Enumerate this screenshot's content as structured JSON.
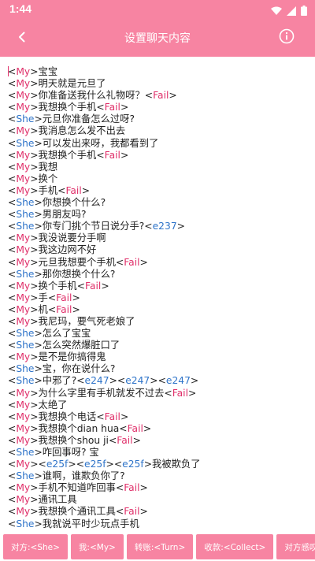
{
  "status_bar": {
    "time": "1:44",
    "colors": {
      "background": "#f784a2",
      "text": "#ffffff"
    }
  },
  "app_bar": {
    "title": "设置聊天内容",
    "back_icon": "arrow-back-icon",
    "info_icon": "info-icon"
  },
  "theme": {
    "accent": "#f784a2",
    "my_tag_color": "#e0306a",
    "she_tag_color": "#2f74c9"
  },
  "editor": {
    "lines": [
      {
        "speaker": "My",
        "parts": [
          {
            "text": "宝宝"
          }
        ]
      },
      {
        "speaker": "My",
        "parts": [
          {
            "text": "明天就是元旦了"
          }
        ]
      },
      {
        "speaker": "My",
        "parts": [
          {
            "text": "你准备送我什么礼物呀？"
          },
          {
            "token": "Fail"
          }
        ]
      },
      {
        "speaker": "My",
        "parts": [
          {
            "text": "我想换个手机"
          },
          {
            "token": "Fail"
          }
        ]
      },
      {
        "speaker": "She",
        "parts": [
          {
            "text": "元旦你准备怎么过呀?"
          }
        ]
      },
      {
        "speaker": "My",
        "parts": [
          {
            "text": "我消息怎么发不出去"
          }
        ]
      },
      {
        "speaker": "She",
        "parts": [
          {
            "text": "可以发出来呀，我都看到了"
          }
        ]
      },
      {
        "speaker": "My",
        "parts": [
          {
            "text": "我想换个手机"
          },
          {
            "token": "Fail"
          }
        ]
      },
      {
        "speaker": "My",
        "parts": [
          {
            "text": "我想"
          }
        ]
      },
      {
        "speaker": "My",
        "parts": [
          {
            "text": "换个"
          }
        ]
      },
      {
        "speaker": "My",
        "parts": [
          {
            "text": "手机"
          },
          {
            "token": "Fail"
          }
        ]
      },
      {
        "speaker": "She",
        "parts": [
          {
            "text": "你想换个什么?"
          }
        ]
      },
      {
        "speaker": "She",
        "parts": [
          {
            "text": "男朋友吗?"
          }
        ]
      },
      {
        "speaker": "She",
        "parts": [
          {
            "text": "你专门挑个节日说分手?"
          },
          {
            "code": "e237"
          }
        ]
      },
      {
        "speaker": "My",
        "parts": [
          {
            "text": "我没说要分手啊"
          }
        ]
      },
      {
        "speaker": "My",
        "parts": [
          {
            "text": "我这边网不好"
          }
        ]
      },
      {
        "speaker": "My",
        "parts": [
          {
            "text": "元旦我想要个手机"
          },
          {
            "token": "Fail"
          }
        ]
      },
      {
        "speaker": "She",
        "parts": [
          {
            "text": "那你想换个什么?"
          }
        ]
      },
      {
        "speaker": "My",
        "parts": [
          {
            "text": "换个手机"
          },
          {
            "token": "Fail"
          }
        ]
      },
      {
        "speaker": "My",
        "parts": [
          {
            "text": "手"
          },
          {
            "token": "Fail"
          }
        ]
      },
      {
        "speaker": "My",
        "parts": [
          {
            "text": "机"
          },
          {
            "token": "Fail"
          }
        ]
      },
      {
        "speaker": "My",
        "parts": [
          {
            "text": "我尼玛，要气死老娘了"
          }
        ]
      },
      {
        "speaker": "She",
        "parts": [
          {
            "text": "怎么了宝宝"
          }
        ]
      },
      {
        "speaker": "She",
        "parts": [
          {
            "text": "怎么突然爆脏口了"
          }
        ]
      },
      {
        "speaker": "My",
        "parts": [
          {
            "text": "是不是你搞得鬼"
          }
        ]
      },
      {
        "speaker": "She",
        "parts": [
          {
            "text": "宝，你在说什么?"
          }
        ]
      },
      {
        "speaker": "She",
        "parts": [
          {
            "text": "中邪了?"
          },
          {
            "code": "e247"
          },
          {
            "code": "e247"
          },
          {
            "code": "e247"
          }
        ]
      },
      {
        "speaker": "My",
        "parts": [
          {
            "text": "为什么字里有手机就发不过去"
          },
          {
            "token": "Fail"
          }
        ]
      },
      {
        "speaker": "My",
        "parts": [
          {
            "text": "太绝了"
          }
        ]
      },
      {
        "speaker": "My",
        "parts": [
          {
            "text": "我想换个电话"
          },
          {
            "token": "Fail"
          }
        ]
      },
      {
        "speaker": "My",
        "parts": [
          {
            "text": "我想换个dian hua"
          },
          {
            "token": "Fail"
          }
        ]
      },
      {
        "speaker": "My",
        "parts": [
          {
            "text": "我想换个shou ji"
          },
          {
            "token": "Fail"
          }
        ]
      },
      {
        "speaker": "She",
        "parts": [
          {
            "text": "咋回事呀? 宝"
          }
        ]
      },
      {
        "speaker": "My",
        "parts": [
          {
            "code": "e25f"
          },
          {
            "code": "e25f"
          },
          {
            "code": "e25f"
          },
          {
            "text": "我被欺负了"
          }
        ]
      },
      {
        "speaker": "She",
        "parts": [
          {
            "text": "谁啊，谁欺负你了?"
          }
        ]
      },
      {
        "speaker": "My",
        "parts": [
          {
            "text": "手机不知道咋回事"
          },
          {
            "token": "Fail"
          }
        ]
      },
      {
        "speaker": "My",
        "parts": [
          {
            "text": "通讯工具"
          }
        ]
      },
      {
        "speaker": "My",
        "parts": [
          {
            "text": "我想换个通讯工具"
          },
          {
            "token": "Fail"
          }
        ]
      },
      {
        "speaker": "She",
        "parts": [
          {
            "text": "我就说平时少玩点手机"
          }
        ]
      }
    ]
  },
  "bottom_bar": {
    "chips": [
      {
        "name": "chip-she",
        "label": "对方:<She>"
      },
      {
        "name": "chip-my",
        "label": "我:<My>"
      },
      {
        "name": "chip-turn",
        "label": "转账:<Turn>"
      },
      {
        "name": "chip-collect",
        "label": "收款:<Collect>"
      },
      {
        "name": "chip-she-voice",
        "label": "对方感叹号:<"
      }
    ]
  }
}
